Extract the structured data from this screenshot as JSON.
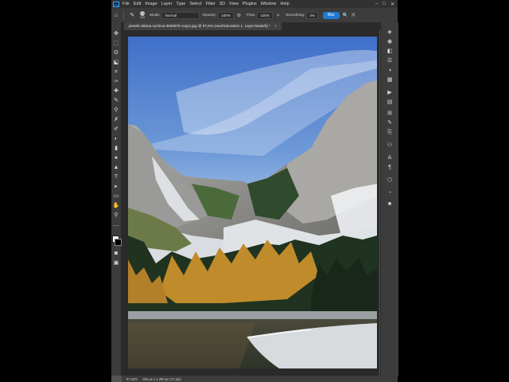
{
  "app": {
    "logo": "Ps"
  },
  "menubar": {
    "items": [
      "File",
      "Edit",
      "Image",
      "Layer",
      "Type",
      "Select",
      "Filter",
      "3D",
      "View",
      "Plugins",
      "Window",
      "Help"
    ],
    "minimize_label": "–",
    "maximize_label": "□",
    "close_label": "✕"
  },
  "options": {
    "home_icon": "⌂",
    "brush_icon": "✎",
    "brush_size": "315",
    "mode_label": "Mode:",
    "mode_value": "Normal",
    "opacity_label": "Opacity:",
    "opacity_value": "100%",
    "flow_label": "Flow:",
    "flow_value": "100%",
    "smoothing_label": "Smoothing:",
    "smoothing_value": "0%",
    "blur_button": "Blur",
    "search_icon": "🔍",
    "share_icon": "⇱"
  },
  "document": {
    "tab_title": "pexels-iuliana-cyrilova-3593879 copy1.jpg @ 97,6% (Hue/Saturation 1, Layer Mask/8) *",
    "close_label": "×"
  },
  "status": {
    "zoom": "97,64%",
    "doc_size": "350 px x 1.280 px (72 ppi)"
  },
  "colors": {
    "accent": "#1f78d1",
    "panel_bg": "#3c3c3c",
    "canvas_bg": "#2a2a2a"
  }
}
